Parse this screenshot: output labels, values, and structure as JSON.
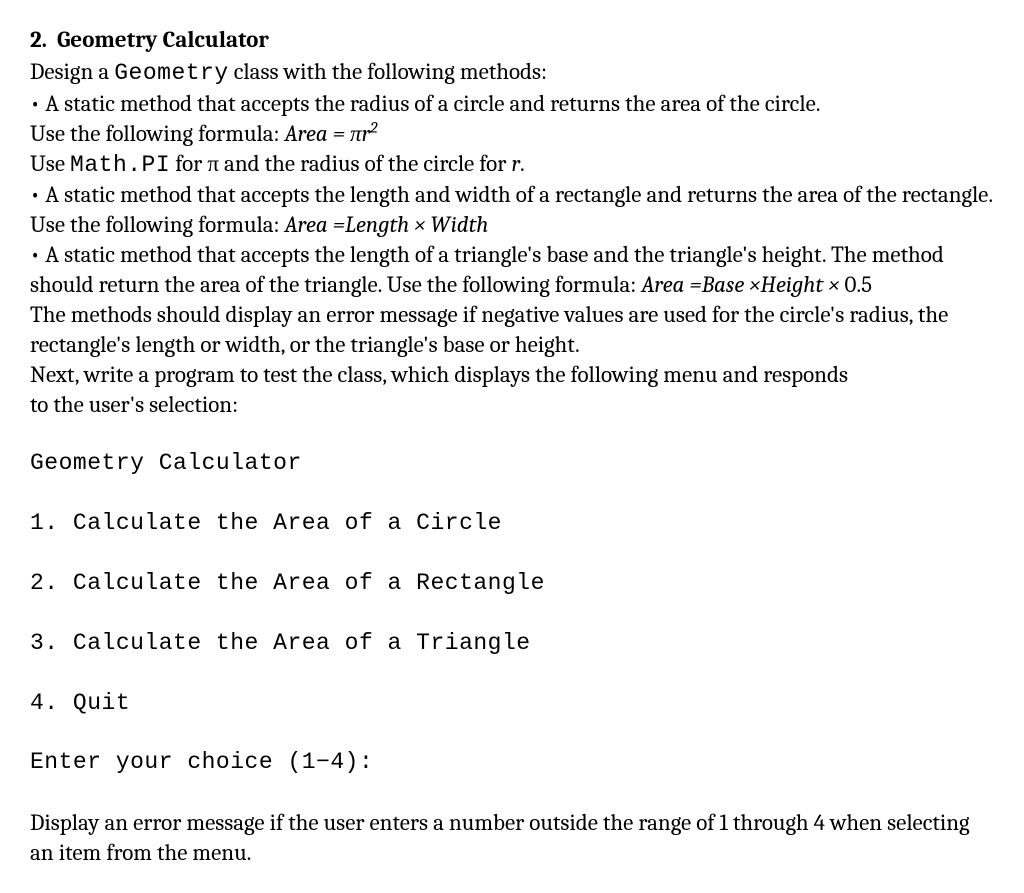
{
  "heading": {
    "number": "2.",
    "title": "Geometry Calculator"
  },
  "intro": {
    "prefix": "Design a ",
    "code": "Geometry",
    "suffix": " class with the following methods:"
  },
  "bullet1": {
    "text": "• A static method that accepts the radius of a circle and returns the area of the circle."
  },
  "formula1": {
    "prefix": "Use the following formula: ",
    "area_eq": "Area",
    "equals": " = π",
    "r": "r",
    "sup": "2"
  },
  "usepi": {
    "prefix": "Use ",
    "code": "Math.PI",
    "mid": " for π and the radius of the circle for ",
    "r": "r",
    "end": "."
  },
  "bullet2": {
    "prefix": "• A static method that accepts the length and width of a rectangle and returns the area of the rectangle. Use the following formula: ",
    "area": "Area",
    "eq": " =",
    "length": "Length",
    "times": " × ",
    "width": "Width"
  },
  "bullet3": {
    "prefix": "• A static method that accepts the length of a triangle's base and the triangle's height.  The method should return the area of the triangle. Use the following formula: ",
    "area": "Area",
    "eq": " =",
    "base": "Base",
    "times": " ×",
    "height": "Height",
    "times2": " × ",
    "half": "0.5"
  },
  "error_para": "The methods should display an error message if negative values are used for the circle's radius, the rectangle's length or width, or the triangle's base or height.",
  "next_para": "Next, write a program to test the class, which displays the following menu and responds",
  "next_para2": "to the user's selection:",
  "menu": {
    "title": "Geometry Calculator",
    "item1": "1. Calculate the Area of a Circle",
    "item2": "2. Calculate the Area of a Rectangle",
    "item3": "3. Calculate the Area of a Triangle",
    "item4": "4. Quit",
    "prompt": "Enter your choice (1−4):"
  },
  "final_para": "Display an error message if the user enters a number outside the range of 1 through 4 when selecting an item from the menu."
}
